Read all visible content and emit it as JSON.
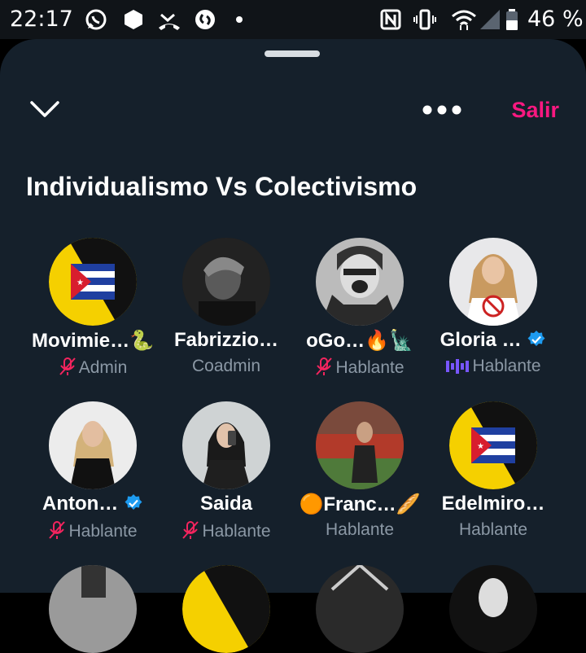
{
  "status_bar": {
    "time": "22:17",
    "battery_percent": "46 %",
    "left_icons": [
      "whatsapp-icon",
      "app-hexagon-icon",
      "missed-call-icon",
      "shazam-icon",
      "dot-icon"
    ],
    "right_icons": [
      "nfc-icon",
      "vibrate-icon",
      "wifi-icon",
      "signal-icon",
      "battery-icon"
    ]
  },
  "header": {
    "collapse_icon": "chevron-down-icon",
    "more_icon": "more-dots-icon",
    "leave_label": "Salir",
    "accent_color": "#f91880"
  },
  "space": {
    "title": "Individualismo Vs Colectivismo"
  },
  "participants": [
    {
      "name": "Movimie…🐍",
      "role": "Admin",
      "mic": "muted",
      "avatar": "cuba-libre-logo"
    },
    {
      "name": "Fabrizzio…",
      "role": "Coadmin",
      "mic": "none",
      "avatar": "dark-portrait"
    },
    {
      "name": "oGo…🔥🗽",
      "role": "Hablante",
      "mic": "muted",
      "avatar": "bw-screaming-man"
    },
    {
      "name": "Gloria …",
      "role": "Hablante",
      "mic": "speaking",
      "verified": true,
      "avatar": "woman-shirt"
    },
    {
      "name": "Anton…",
      "role": "Hablante",
      "mic": "muted",
      "verified": true,
      "avatar": "woman-black-top"
    },
    {
      "name": "Saida",
      "role": "Hablante",
      "mic": "muted",
      "avatar": "woman-selfie"
    },
    {
      "name": "🟠Franc…🥖",
      "role": "Hablante",
      "mic": "none",
      "avatar": "man-stadium"
    },
    {
      "name": "Edelmiro…",
      "role": "Hablante",
      "mic": "none",
      "avatar": "cuba-libre-logo"
    }
  ],
  "colors": {
    "sheet_bg": "#15202b",
    "muted_mic": "#f4245e",
    "speaking": "#7856ff",
    "verified": "#1d9bf0",
    "role_text": "#8b98a5"
  }
}
